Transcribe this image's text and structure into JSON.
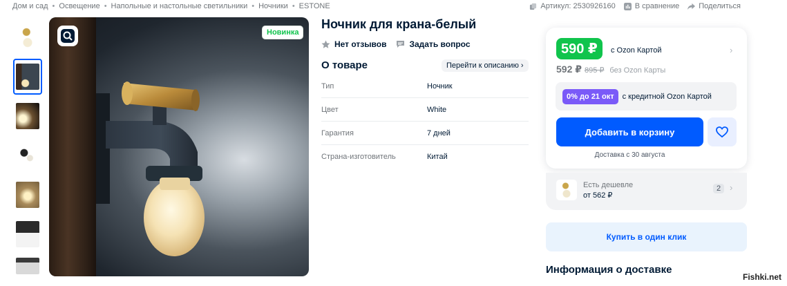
{
  "breadcrumb": [
    "Дом и сад",
    "Освещение",
    "Напольные и настольные светильники",
    "Ночники",
    "ESTONE"
  ],
  "meta": {
    "article": "Артикул: 2530926160",
    "compare": "В сравнение",
    "share": "Поделиться"
  },
  "gallery": {
    "badge": "Новинка",
    "thumbnails": 7,
    "active_thumbnail": 2
  },
  "product": {
    "title": "Ночник для крана-белый",
    "reviews": "Нет отзывов",
    "ask": "Задать вопрос"
  },
  "about": {
    "heading": "О товаре",
    "goto": "Перейти к описанию",
    "specs": [
      {
        "key": "Тип",
        "value": "Ночник"
      },
      {
        "key": "Цвет",
        "value": "White"
      },
      {
        "key": "Гарантия",
        "value": "7 дней"
      },
      {
        "key": "Страна-изготовитель",
        "value": "Китай"
      }
    ]
  },
  "buy": {
    "price_card": "590 ₽",
    "price_card_label": "с Ozon Картой",
    "price_regular": "592 ₽",
    "price_old": "895 ₽",
    "price_regular_label": "без Ozon Карты",
    "credit_pill": "0% до 21 окт",
    "credit_text": "с кредитной Ozon Картой",
    "add_to_cart": "Добавить в корзину",
    "delivery": "Доставка с 30 августа"
  },
  "cheaper": {
    "line1": "Есть дешевле",
    "line2": "от 562 ₽",
    "count": "2"
  },
  "one_click": "Купить в один клик",
  "delivery_info": "Информация о доставке",
  "watermark": "Fishki.net",
  "colors": {
    "brand_blue": "#005bff",
    "price_green": "#10c44c",
    "credit_purple": "#7a5af8"
  }
}
